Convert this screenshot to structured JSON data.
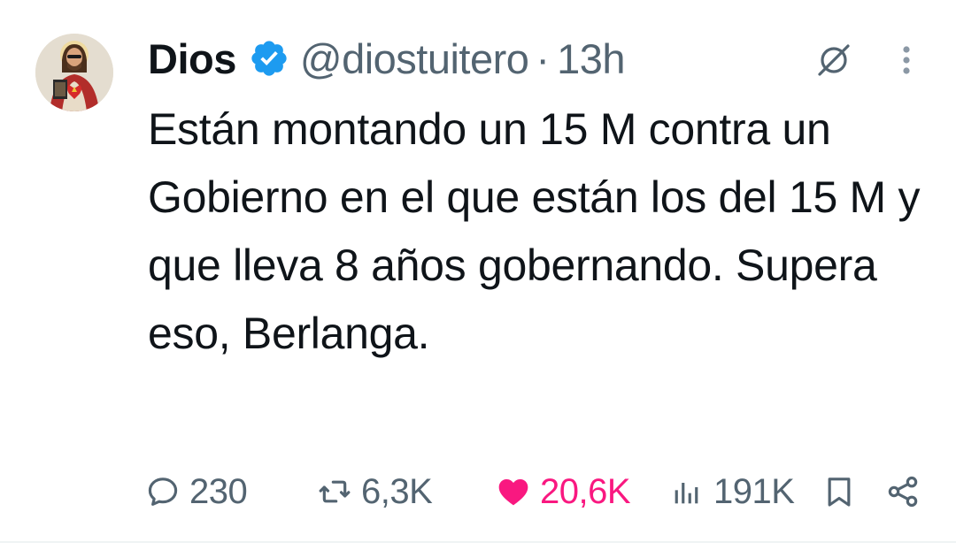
{
  "author": {
    "name": "Dios",
    "handle": "@diostuitero",
    "separator": "·",
    "time": "13h",
    "verified": true,
    "avatar_icon": "sacred-heart-avatar"
  },
  "tweet": {
    "text": "Están montando un 15 M contra un Gobierno en el que están los del 15 M y que lleva 8 años gobernando. Supera eso, Berlanga."
  },
  "actions": {
    "replies": "230",
    "retweets": "6,3K",
    "likes": "20,6K",
    "views": "191K",
    "liked": true
  },
  "colors": {
    "text": "#0f1419",
    "secondary": "#536471",
    "verified": "#1d9bf0",
    "like": "#f91880",
    "divider": "#eff3f4"
  }
}
